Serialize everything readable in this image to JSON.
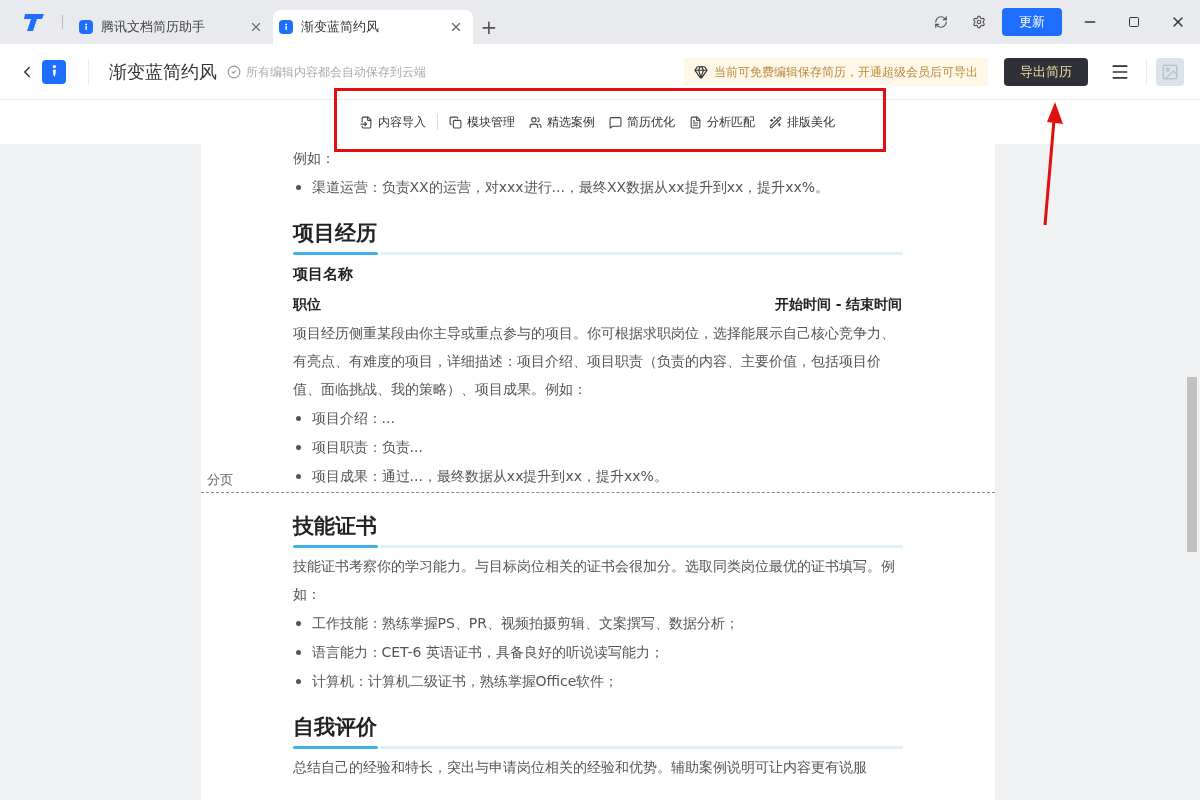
{
  "tabs": [
    {
      "label": "腾讯文档简历助手",
      "selected": false
    },
    {
      "label": "渐变蓝简约风",
      "selected": true
    }
  ],
  "new_tab": "+",
  "update_button": "更新",
  "header": {
    "title": "渐变蓝简约风",
    "save_status": "所有编辑内容都会自动保存到云端",
    "notice": "当前可免费编辑保存简历，开通超级会员后可导出",
    "export_button": "导出简历"
  },
  "toolbar": [
    {
      "label": "内容导入"
    },
    {
      "label": "模块管理"
    },
    {
      "label": "精选案例"
    },
    {
      "label": "简历优化"
    },
    {
      "label": "分析匹配"
    },
    {
      "label": "排版美化"
    }
  ],
  "page_break_label": "分页",
  "document": [
    {
      "kind": "text",
      "text": "例如："
    },
    {
      "kind": "bullet",
      "text": "渠道运营：负责XX的运营，对xxx进行...，最终XX数据从xx提升到xx，提升xx%。"
    },
    {
      "kind": "heading",
      "text": "项目经历"
    },
    {
      "kind": "subheading",
      "text": "项目名称"
    },
    {
      "kind": "role",
      "text": "职位",
      "date": "开始时间 - 结束时间"
    },
    {
      "kind": "text",
      "text": "项目经历侧重某段由你主导或重点参与的项目。你可根据求职岗位，选择能展示自己核心竞争力、有亮点、有难度的项目，详细描述：项目介绍、项目职责（负责的内容、主要价值，包括项目价值、面临挑战、我的策略）、项目成果。例如："
    },
    {
      "kind": "bullet",
      "text": "项目介绍：..."
    },
    {
      "kind": "bullet",
      "text": "项目职责：负责..."
    },
    {
      "kind": "bullet",
      "text": "项目成果：通过...，最终数据从xx提升到xx，提升xx%。"
    },
    {
      "kind": "pagebreak"
    },
    {
      "kind": "heading",
      "text": "技能证书"
    },
    {
      "kind": "text",
      "text": "技能证书考察你的学习能力。与目标岗位相关的证书会很加分。选取同类岗位最优的证书填写。例如："
    },
    {
      "kind": "bullet",
      "text": "工作技能：熟练掌握PS、PR、视频拍摄剪辑、文案撰写、数据分析；"
    },
    {
      "kind": "bullet",
      "text": "语言能力：CET-6 英语证书，具备良好的听说读写能力；"
    },
    {
      "kind": "bullet",
      "text": "计算机：计算机二级证书，熟练掌握Office软件；"
    },
    {
      "kind": "heading",
      "text": "自我评价"
    },
    {
      "kind": "text",
      "text": "总结自己的经验和特长，突出与申请岗位相关的经验和优势。辅助案例说明可让内容更有说服"
    }
  ]
}
